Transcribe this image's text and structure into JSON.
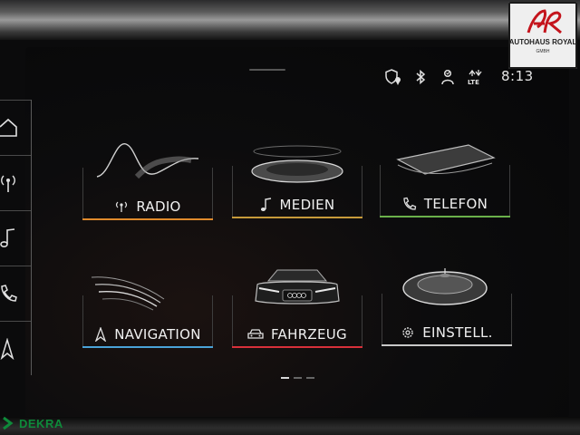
{
  "status_bar": {
    "time": "8:13",
    "icons": [
      "privacy-location-icon",
      "bluetooth-icon",
      "user-profile-icon",
      "lte-icon"
    ],
    "lte_text": "LTE"
  },
  "rail": {
    "items": [
      "home-icon",
      "radio-icon",
      "media-icon",
      "phone-icon",
      "navigation-icon"
    ]
  },
  "tiles": [
    {
      "id": "radio",
      "label": "RADIO",
      "accent": "#e08a2c"
    },
    {
      "id": "media",
      "label": "MEDIEN",
      "accent": "#c79a3a"
    },
    {
      "id": "phone",
      "label": "TELEFON",
      "accent": "#6ab04a"
    },
    {
      "id": "navigation",
      "label": "NAVIGATION",
      "accent": "#4aa3d8"
    },
    {
      "id": "vehicle",
      "label": "FAHRZEUG",
      "accent": "#d8303a"
    },
    {
      "id": "settings",
      "label": "EINSTELL.",
      "accent": "#c8c8c8"
    }
  ],
  "pager": {
    "pages": 3,
    "active": 0
  },
  "watermarks": {
    "dealer_name": "AUTOHAUS ROYAL",
    "dealer_sub": "GMBH",
    "dealer_monogram": "AR",
    "inspection": "DEKRA"
  }
}
